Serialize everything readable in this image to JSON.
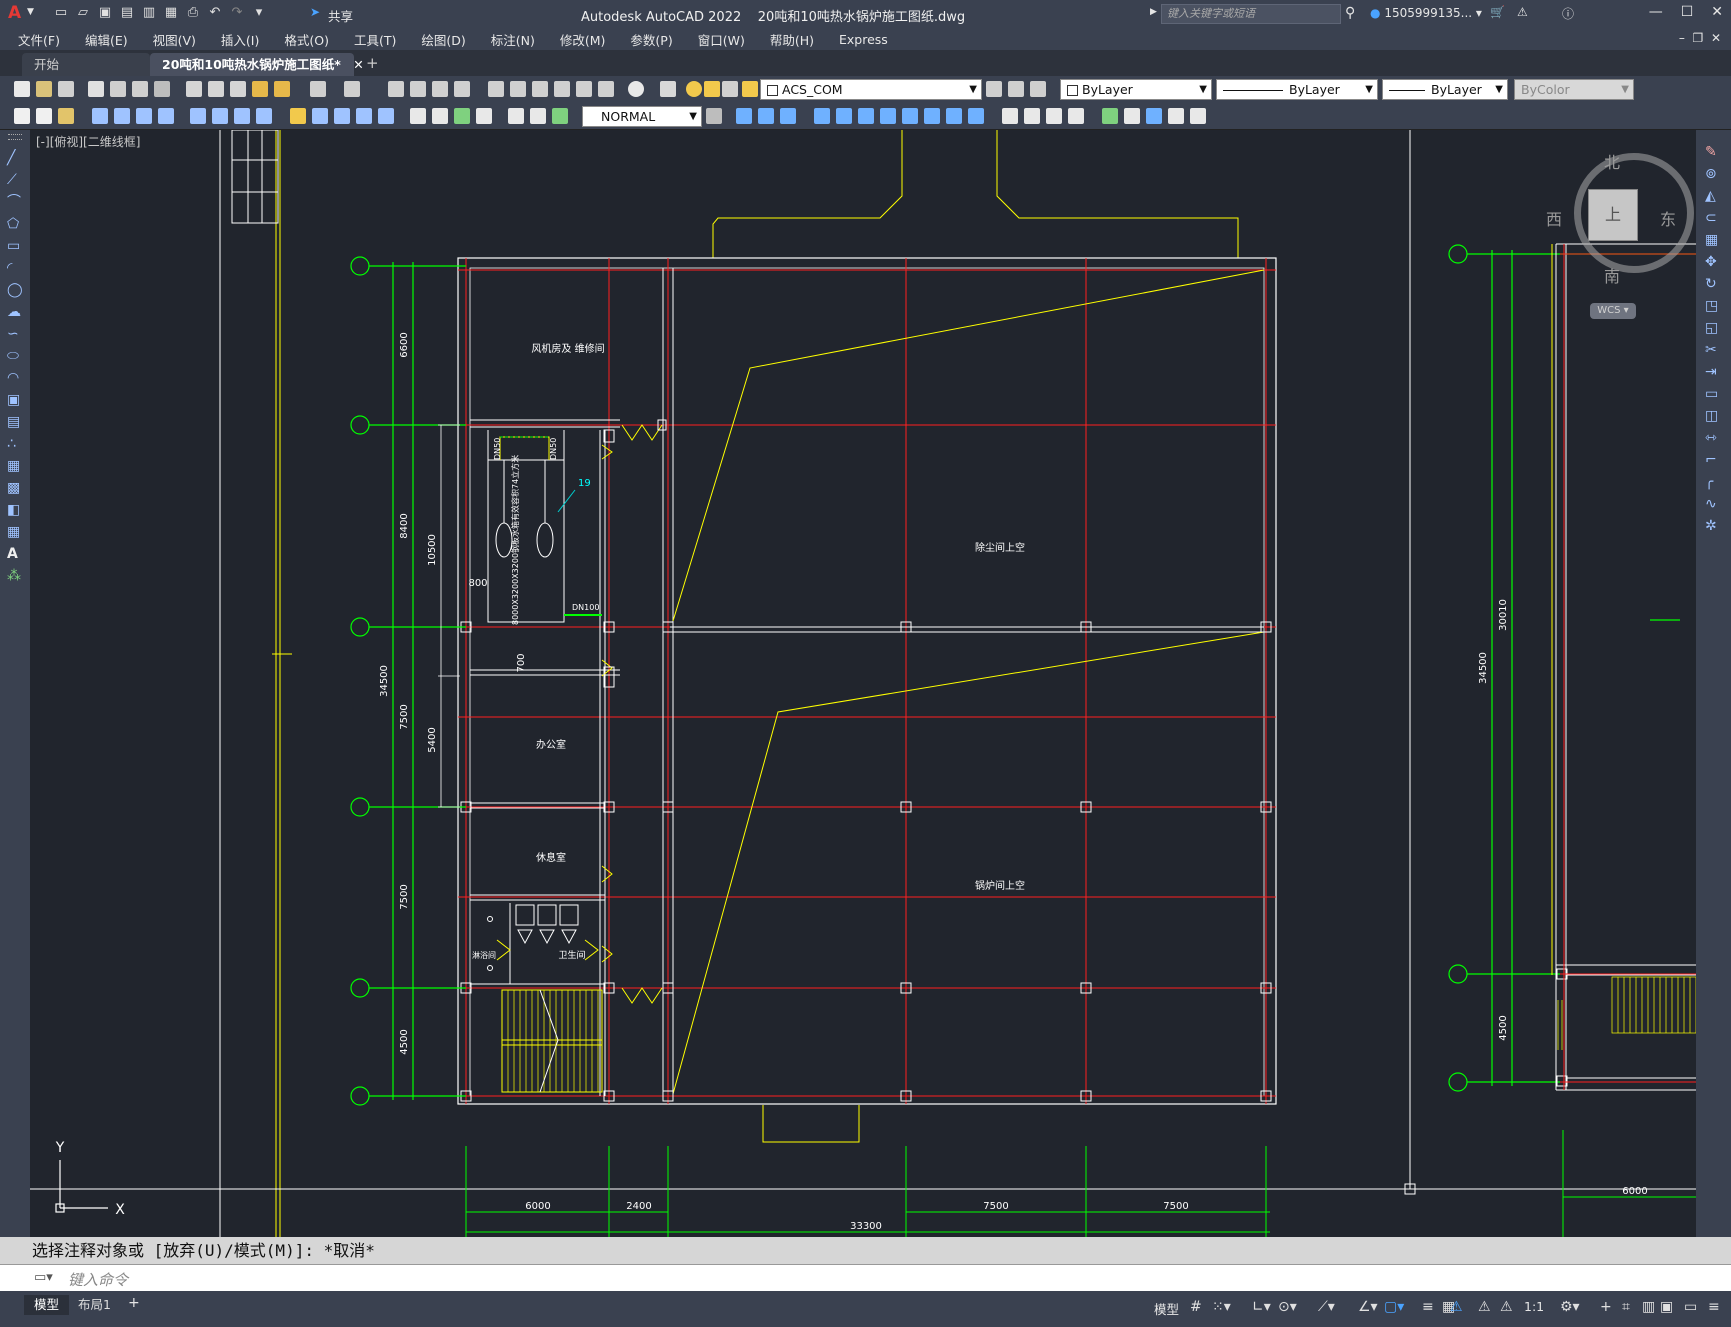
{
  "titlebar": {
    "app_title": "Autodesk AutoCAD 2022",
    "doc_name": "20吨和10吨热水锅炉施工图纸.dwg",
    "share_label": "共享",
    "search_placeholder": "键入关键字或短语",
    "user": "1505999135..."
  },
  "menubar": {
    "items": [
      "文件(F)",
      "编辑(E)",
      "视图(V)",
      "插入(I)",
      "格式(O)",
      "工具(T)",
      "绘图(D)",
      "标注(N)",
      "修改(M)",
      "参数(P)",
      "窗口(W)",
      "帮助(H)",
      "Express"
    ]
  },
  "tabs": {
    "start": "开始",
    "document": "20吨和10吨热水锅炉施工图纸*"
  },
  "toolbar": {
    "layer": "ACS_COM",
    "color": "ByLayer",
    "linetype": "ByLayer",
    "lineweight": "ByLayer",
    "plotstyle": "ByColor",
    "dimstyle": "NORMAL"
  },
  "viewport": {
    "label": "[-][俯视][二维线框]",
    "viewcube": {
      "top": "上",
      "north": "北",
      "south": "南",
      "east": "东",
      "west": "西",
      "wcs": "WCS"
    },
    "ucs": {
      "x": "X",
      "y": "Y"
    }
  },
  "drawing": {
    "rooms": [
      "风机房及 维修间",
      "除尘间上空",
      "办公室",
      "休息室",
      "卫生间",
      "淋浴间",
      "锅炉间上空"
    ],
    "equipment": "8000X3200X3200钢板水箱有效容积74立方米",
    "labels": {
      "dn50a": "DN50",
      "dn50b": "DN50",
      "dn100": "DN100",
      "tag19": "19"
    },
    "dims_left": [
      "6600",
      "8400",
      "7500",
      "7500",
      "4500",
      "34500",
      "10500",
      "5400",
      "800",
      "700"
    ],
    "dims_bottom": [
      "6000",
      "2400",
      "7500",
      "7500",
      "33300"
    ],
    "dims_right": [
      "30010",
      "34500",
      "4500",
      "6000"
    ]
  },
  "command": {
    "history": "选择注释对象或 [放弃(U)/模式(M)]: *取消*",
    "placeholder": "键入命令"
  },
  "status": {
    "model_tab": "模型",
    "layout_tab": "布局1",
    "model_btn": "模型",
    "scale": "1:1"
  }
}
